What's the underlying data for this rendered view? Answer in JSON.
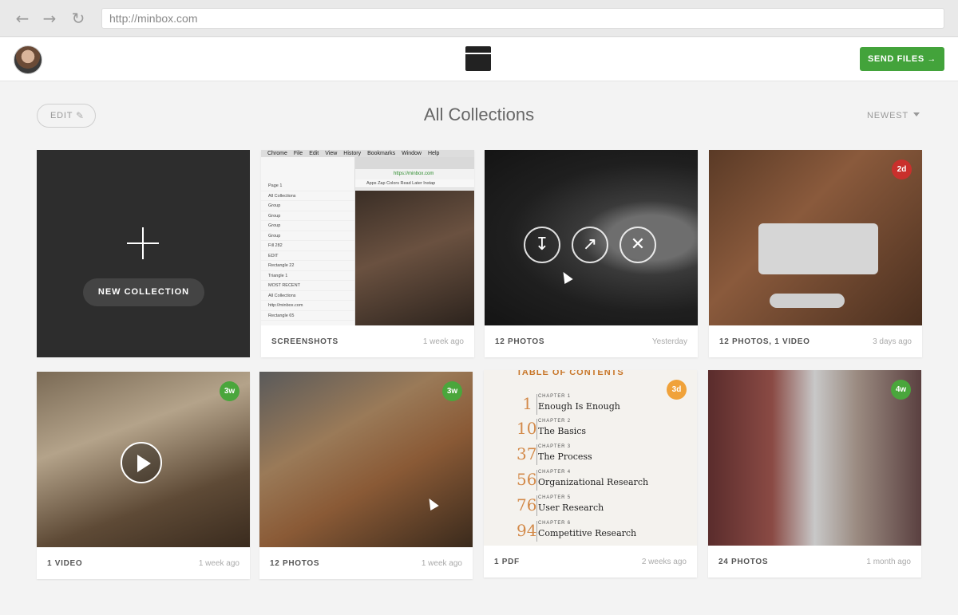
{
  "browser": {
    "url": "http://minbox.com"
  },
  "header": {
    "send_label": "SEND FILES →"
  },
  "toolbar": {
    "edit_label": "EDIT",
    "title": "All Collections",
    "sort_label": "NEWEST"
  },
  "new_collection": {
    "label": "NEW COLLECTION"
  },
  "cards": [
    {
      "count": "SCREENSHOTS",
      "when": "1 week ago"
    },
    {
      "count": "12 PHOTOS",
      "when": "Yesterday"
    },
    {
      "count": "12 PHOTOS, 1 VIDEO",
      "when": "3 days ago",
      "badge": "2d",
      "badge_color": "#c9302c"
    },
    {
      "count": "1 VIDEO",
      "when": "1 week ago",
      "badge": "3w",
      "badge_color": "#4aa63c"
    },
    {
      "count": "12 PHOTOS",
      "when": "1 week ago",
      "badge": "3w",
      "badge_color": "#4aa63c"
    },
    {
      "count": "1 PDF",
      "when": "2 weeks ago",
      "badge": "3d",
      "badge_color": "#f0a23a"
    },
    {
      "count": "24 PHOTOS",
      "when": "1 month ago",
      "badge": "4w",
      "badge_color": "#4aa63c"
    }
  ],
  "screenshot_thumb": {
    "menu": [
      "Chrome",
      "File",
      "Edit",
      "View",
      "History",
      "Bookmarks",
      "Window",
      "Help"
    ],
    "layers": [
      "Page 1",
      "All Collections",
      "Group",
      "Group",
      "Group",
      "Group",
      "Fill 282",
      "EDIT",
      "Rectangle 22",
      "Triangle 1",
      "MOST RECENT",
      "All Collections",
      "http://minbox.com",
      "Rectangle 65"
    ],
    "url": "https://minbox.com",
    "bookmarks": "Apps   Zap Colors   Read Later   Instap"
  },
  "pdf_thumb": {
    "title": "TABLE OF CONTENTS",
    "chapters": [
      {
        "num": "1",
        "label": "CHAPTER 1",
        "name": "Enough Is Enough"
      },
      {
        "num": "10",
        "label": "CHAPTER 2",
        "name": "The Basics"
      },
      {
        "num": "37",
        "label": "CHAPTER 3",
        "name": "The Process"
      },
      {
        "num": "56",
        "label": "CHAPTER 4",
        "name": "Organizational Research"
      },
      {
        "num": "76",
        "label": "CHAPTER 5",
        "name": "User Research"
      },
      {
        "num": "94",
        "label": "CHAPTER 6",
        "name": "Competitive Research"
      }
    ]
  }
}
